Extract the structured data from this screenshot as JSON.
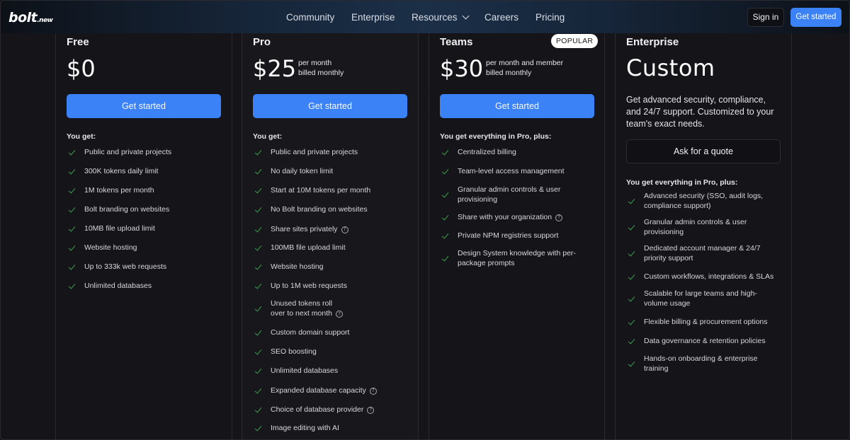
{
  "header": {
    "logo": "bolt",
    "logo_suffix": ".new",
    "nav": [
      "Community",
      "Enterprise",
      "Resources",
      "Careers",
      "Pricing"
    ],
    "sign_in": "Sign in",
    "get_started": "Get started"
  },
  "plans": [
    {
      "name": "Free",
      "price": "$0",
      "cta": "Get started",
      "you_get": "You get:",
      "features": [
        {
          "text": "Public and private projects"
        },
        {
          "text": "300K tokens daily limit"
        },
        {
          "text": "1M tokens per month"
        },
        {
          "text": "Bolt branding on websites"
        },
        {
          "text": "10MB file upload limit"
        },
        {
          "text": "Website hosting"
        },
        {
          "text": "Up to 333k web requests"
        },
        {
          "text": "Unlimited databases"
        }
      ]
    },
    {
      "name": "Pro",
      "price": "$25",
      "price_note_1": "per month",
      "price_note_2": "billed monthly",
      "cta": "Get started",
      "you_get": "You get:",
      "features": [
        {
          "text": "Public and private projects"
        },
        {
          "text": "No daily token limit"
        },
        {
          "text": "Start at 10M tokens per month"
        },
        {
          "text": "No Bolt branding on websites"
        },
        {
          "text": "Share sites privately",
          "help": true
        },
        {
          "text": "100MB file upload limit"
        },
        {
          "text": "Website hosting"
        },
        {
          "text": "Up to 1M web requests"
        },
        {
          "text": "Unused tokens roll",
          "text2": "over to next month",
          "help": true
        },
        {
          "text": "Custom domain support"
        },
        {
          "text": "SEO boosting"
        },
        {
          "text": "Unlimited databases"
        },
        {
          "text": "Expanded database capacity",
          "help": true
        },
        {
          "text": "Choice of database provider",
          "help": true
        },
        {
          "text": "Image editing with AI"
        }
      ]
    },
    {
      "name": "Teams",
      "badge": "POPULAR",
      "price": "$30",
      "price_note_1": "per month and member",
      "price_note_2": "billed monthly",
      "cta": "Get started",
      "you_get": "You get everything in Pro, plus:",
      "features": [
        {
          "text": "Centralized billing"
        },
        {
          "text": "Team-level access management"
        },
        {
          "text": "Granular admin controls & user",
          "text2": "provisioning"
        },
        {
          "text": "Share with your organization",
          "help": true
        },
        {
          "text": "Private NPM registries support"
        },
        {
          "text": "Design System knowledge with per-",
          "text2": "package prompts"
        }
      ]
    },
    {
      "name": "Enterprise",
      "price": "Custom",
      "description": "Get advanced security, compliance, and 24/7 support. Customized to your team's exact needs.",
      "cta": "Ask for a quote",
      "you_get": "You get everything in Pro, plus:",
      "features": [
        {
          "text": "Advanced security (SSO, audit logs,",
          "text2": "compliance support)"
        },
        {
          "text": "Granular admin controls & user",
          "text2": "provisioning"
        },
        {
          "text": "Dedicated account manager & 24/7",
          "text2": "priority support"
        },
        {
          "text": "Custom workflows, integrations & SLAs"
        },
        {
          "text": "Scalable for large teams and high-",
          "text2": "volume usage"
        },
        {
          "text": "Flexible billing & procurement options"
        },
        {
          "text": "Data governance & retention policies"
        },
        {
          "text": "Hands-on onboarding & enterprise",
          "text2": "training"
        }
      ]
    }
  ]
}
